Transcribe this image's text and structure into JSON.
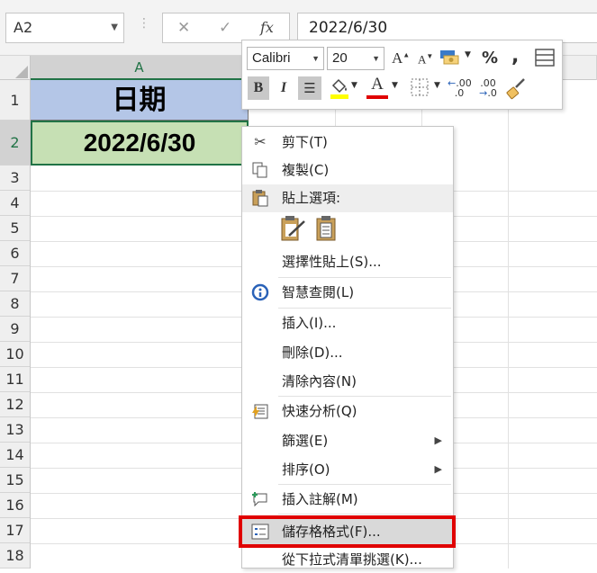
{
  "formula_bar": {
    "name_box": "A2",
    "cancel_glyph": "✕",
    "enter_glyph": "✓",
    "fx_label": "fx",
    "formula_value": "2022/6/30"
  },
  "grid": {
    "columns": [
      "A"
    ],
    "rows": [
      "1",
      "2",
      "3",
      "4",
      "5",
      "6",
      "7",
      "8",
      "9",
      "10",
      "11",
      "12",
      "13",
      "14",
      "15",
      "16",
      "17",
      "18"
    ],
    "cells": {
      "A1": "日期",
      "A2": "2022/6/30"
    },
    "header_color": "#b4c6e7",
    "value_color": "#c6e0b4",
    "accent": "#217346"
  },
  "mini_toolbar": {
    "font_name": "Calibri",
    "font_size": "20",
    "grow_font": "A",
    "shrink_font": "A",
    "percent": "%",
    "comma": ",",
    "bold": "B",
    "italic": "I",
    "font_color_letter": "A",
    "increase_decimal": ".00",
    "decrease_decimal": ".00",
    "font_color": "#e00000",
    "fill_color": "#ffff00"
  },
  "context_menu": {
    "items": [
      {
        "label": "剪下(T)",
        "icon": "scissors-icon"
      },
      {
        "label": "複製(C)",
        "icon": "copy-icon"
      },
      {
        "label": "貼上選項:",
        "icon": "clipboard-icon"
      },
      {
        "label": "選擇性貼上(S)...",
        "icon": ""
      },
      {
        "label": "智慧查閱(L)",
        "icon": "smart-lookup-icon"
      },
      {
        "label": "插入(I)...",
        "icon": ""
      },
      {
        "label": "刪除(D)...",
        "icon": ""
      },
      {
        "label": "清除內容(N)",
        "icon": ""
      },
      {
        "label": "快速分析(Q)",
        "icon": "quick-analysis-icon"
      },
      {
        "label": "篩選(E)",
        "icon": "",
        "submenu": true
      },
      {
        "label": "排序(O)",
        "icon": "",
        "submenu": true
      },
      {
        "label": "插入註解(M)",
        "icon": "comment-icon"
      },
      {
        "label": "儲存格格式(F)...",
        "icon": "format-cells-icon"
      },
      {
        "label": "從下拉式清單挑選(K)...",
        "icon": ""
      }
    ],
    "highlight_color": "#e00000"
  }
}
